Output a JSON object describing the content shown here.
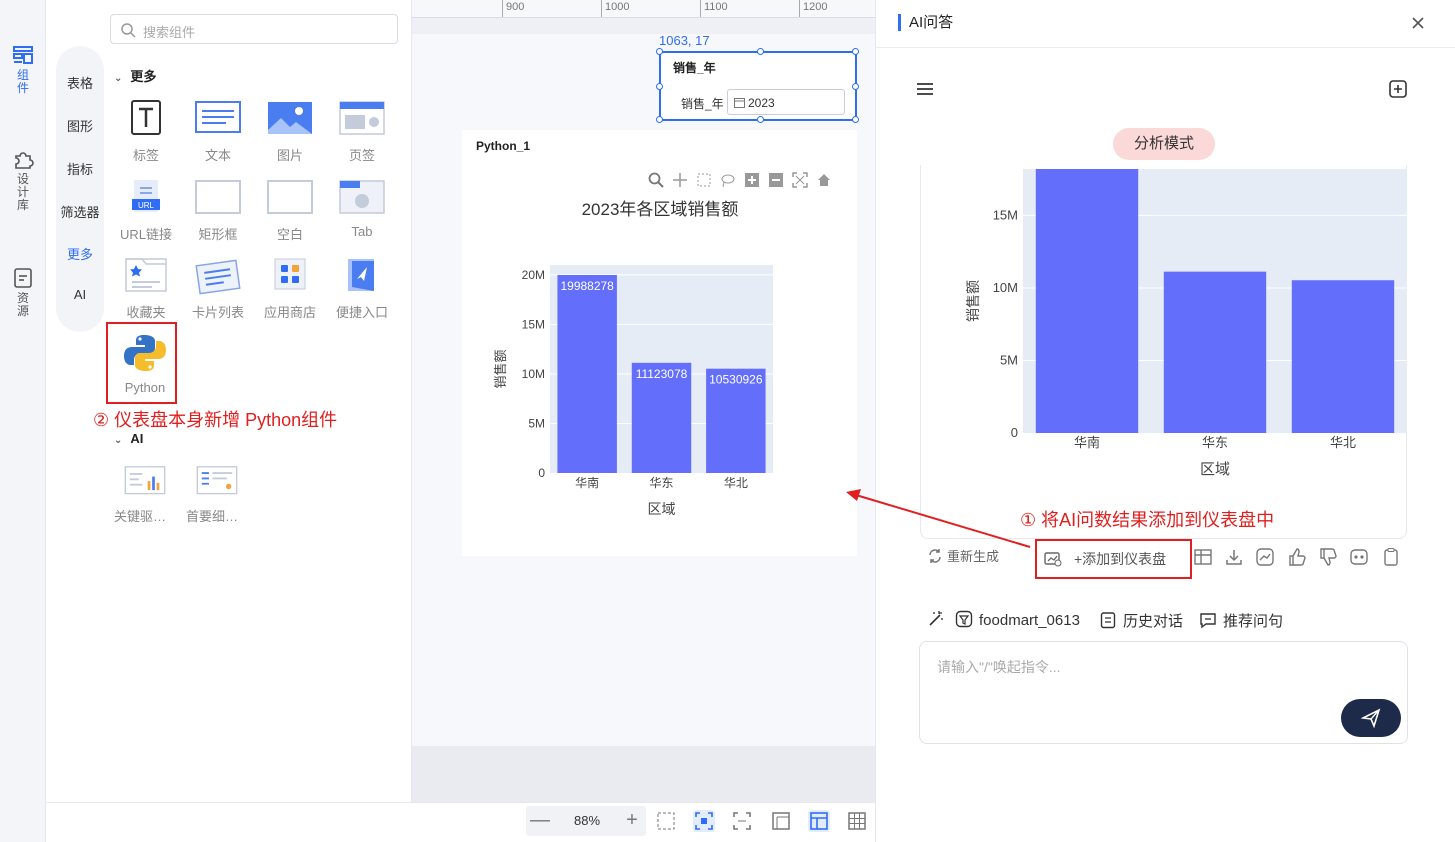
{
  "rail": {
    "items": [
      {
        "label": "组件",
        "icon": "component-icon"
      },
      {
        "label": "设计库",
        "icon": "puzzle-icon"
      },
      {
        "label": "资源",
        "icon": "resource-icon"
      }
    ]
  },
  "categories": [
    "表格",
    "图形",
    "指标",
    "筛选器",
    "更多",
    "AI"
  ],
  "search": {
    "placeholder": "搜索组件"
  },
  "groups": {
    "more": "更多",
    "ai": "AI"
  },
  "components": {
    "row1": [
      "标签",
      "文本",
      "图片",
      "页签"
    ],
    "row2": [
      "URL链接",
      "矩形框",
      "空白",
      "Tab"
    ],
    "row3": [
      "收藏夹",
      "卡片列表",
      "应用商店",
      "便捷入口"
    ],
    "python": "Python",
    "ai": [
      "关键驱动…",
      "首要细分…"
    ],
    "url_badge": "URL"
  },
  "annotations": {
    "left": "② 仪表盘本身新增 Python组件",
    "right": "① 将AI问数结果添加到仪表盘中"
  },
  "ruler": {
    "marks": [
      "900",
      "1000",
      "1100",
      "1200"
    ]
  },
  "filter": {
    "coord": "1063, 17",
    "title": "销售_年",
    "label": "销售_年",
    "value": "2023"
  },
  "card": {
    "title": "Python_1"
  },
  "chart_data": [
    {
      "type": "bar",
      "title": "2023年各区域销售额",
      "xlabel": "区域",
      "ylabel": "销售额",
      "categories": [
        "华南",
        "华东",
        "华北"
      ],
      "values": [
        19988278,
        11123078,
        10530926
      ],
      "data_labels": [
        "19988278",
        "11123078",
        "10530926"
      ],
      "ylim": [
        0,
        21000000
      ],
      "yticks": [
        "0",
        "5M",
        "10M",
        "15M",
        "20M"
      ],
      "ytick_values": [
        0,
        5000000,
        10000000,
        15000000,
        20000000
      ],
      "bar_color": "#636efa",
      "bg_color": "#e5ecf6",
      "grid": true
    },
    {
      "type": "bar",
      "title": "",
      "xlabel": "区域",
      "ylabel": "销售额",
      "categories": [
        "华南",
        "华东",
        "华北"
      ],
      "values": [
        19988278,
        11123078,
        10530926
      ],
      "ylim": [
        0,
        18200000
      ],
      "yticks": [
        "0",
        "5M",
        "10M",
        "15M"
      ],
      "ytick_values": [
        0,
        5000000,
        10000000,
        15000000
      ],
      "bar_color": "#636efa",
      "bg_color": "#e5ecf6",
      "grid": true
    }
  ],
  "zoom": {
    "value": "88%",
    "minus": "—",
    "plus": "+"
  },
  "ai": {
    "title": "AI问答",
    "mode": "分析模式",
    "regenerate": "重新生成",
    "add_to_dashboard": "+添加到仪表盘",
    "dataset": "foodmart_0613",
    "history": "历史对话",
    "recommend": "推荐问句",
    "input_placeholder": "请输入\"/\"唤起指令..."
  },
  "colors": {
    "accent": "#2f6df6",
    "annotation": "#e02020",
    "send": "#1d2a4a"
  }
}
